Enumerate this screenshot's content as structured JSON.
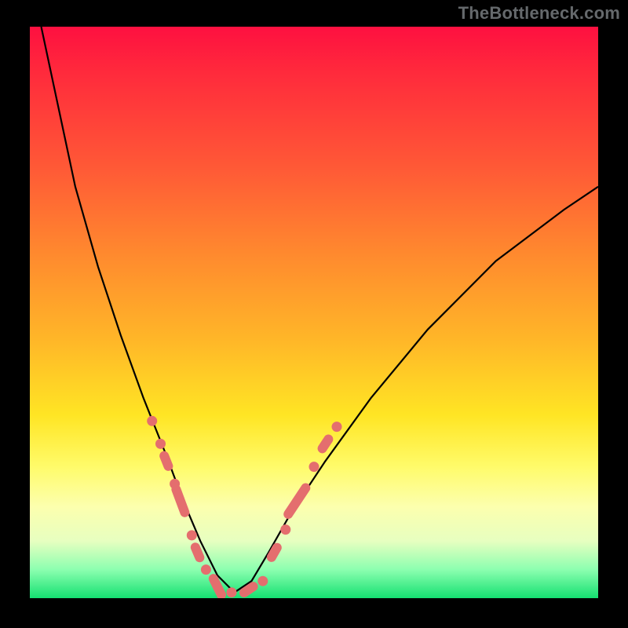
{
  "watermark": "TheBottleneck.com",
  "colors": {
    "frame_bg": "#000000",
    "gradient_top": "#fe1040",
    "gradient_mid1": "#ff8a2e",
    "gradient_mid2": "#ffe524",
    "gradient_bottom": "#14e071",
    "curve": "#000000",
    "marker": "#e46e6e",
    "watermark": "#65696c"
  },
  "chart_data": {
    "type": "line",
    "title": "",
    "xlabel": "",
    "ylabel": "",
    "xlim": [
      0,
      100
    ],
    "ylim": [
      0,
      100
    ],
    "comment": "V-shaped bottleneck curve with vertex near x≈36. y is percentage (0=bottom green, 100=top red). Values estimated from gradient position.",
    "series": [
      {
        "name": "bottleneck-curve",
        "x": [
          2,
          5,
          8,
          12,
          16,
          20,
          24,
          27,
          30,
          33,
          36,
          39,
          42,
          46,
          52,
          60,
          70,
          82,
          94,
          100
        ],
        "y": [
          100,
          86,
          72,
          58,
          46,
          35,
          25,
          17,
          10,
          4,
          1,
          3,
          8,
          15,
          24,
          35,
          47,
          59,
          68,
          72
        ]
      }
    ],
    "markers_left": {
      "comment": "Pink dot/pill markers along left branch (x,y in same 0-100 space)",
      "points": [
        {
          "x": 21.5,
          "y": 31
        },
        {
          "x": 23,
          "y": 27
        },
        {
          "x": 24,
          "y": 24,
          "pill": true,
          "len": 3
        },
        {
          "x": 25.5,
          "y": 20
        },
        {
          "x": 26.5,
          "y": 17,
          "pill": true,
          "len": 5
        },
        {
          "x": 28.5,
          "y": 11
        },
        {
          "x": 29.5,
          "y": 8,
          "pill": true,
          "len": 3
        },
        {
          "x": 31,
          "y": 5
        },
        {
          "x": 33,
          "y": 2,
          "pill": true,
          "len": 4
        },
        {
          "x": 35.5,
          "y": 1
        }
      ]
    },
    "markers_right": {
      "points": [
        {
          "x": 38.5,
          "y": 1.5,
          "pill": true,
          "len": 3
        },
        {
          "x": 41,
          "y": 3
        },
        {
          "x": 43,
          "y": 8,
          "pill": true,
          "len": 3
        },
        {
          "x": 45,
          "y": 12
        },
        {
          "x": 47,
          "y": 17,
          "pill": true,
          "len": 6
        },
        {
          "x": 50,
          "y": 23
        },
        {
          "x": 52,
          "y": 27,
          "pill": true,
          "len": 3
        },
        {
          "x": 54,
          "y": 30
        }
      ]
    }
  }
}
